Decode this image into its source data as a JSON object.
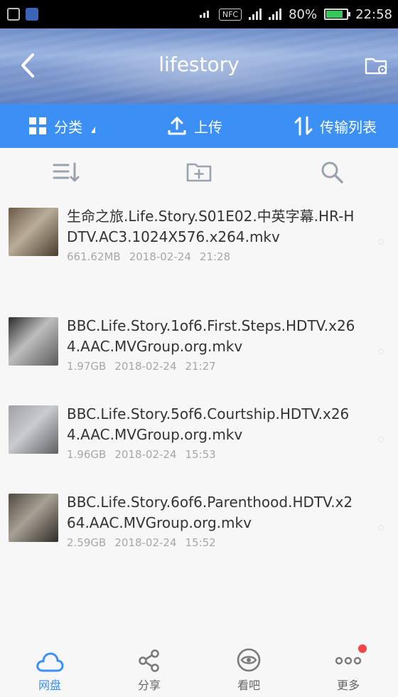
{
  "status_bar": {
    "nfc": "NFC",
    "battery": "80%",
    "battery_level": 0.8,
    "time": "22:58"
  },
  "header": {
    "title": "lifestory"
  },
  "toolbar": {
    "category": "分类",
    "upload": "上传",
    "transfer_list": "传输列表"
  },
  "files": [
    {
      "name": "生命之旅.Life.Story.S01E02.中英字幕.HR-HDTV.AC3.1024X576.x264.mkv",
      "size": "661.62MB",
      "date": "2018-02-24",
      "time": "21:28",
      "thumb_colors": [
        "#6b5a45",
        "#b9ad99",
        "#4a3c2c"
      ]
    },
    {
      "name": "BBC.Life.Story.1of6.First.Steps.HDTV.x264.AAC.MVGroup.org.mkv",
      "size": "1.97GB",
      "date": "2018-02-24",
      "time": "21:27",
      "thumb_colors": [
        "#2c2c2c",
        "#bdbdbd",
        "#5a5a5a"
      ]
    },
    {
      "name": "BBC.Life.Story.5of6.Courtship.HDTV.x264.AAC.MVGroup.org.mkv",
      "size": "1.96GB",
      "date": "2018-02-24",
      "time": "15:53",
      "thumb_colors": [
        "#9ea0a3",
        "#c9cccf",
        "#5e6062"
      ]
    },
    {
      "name": "BBC.Life.Story.6of6.Parenthood.HDTV.x264.AAC.MVGroup.org.mkv",
      "size": "2.59GB",
      "date": "2018-02-24",
      "time": "15:52",
      "thumb_colors": [
        "#4f4a42",
        "#a7a094",
        "#2f2b26"
      ]
    }
  ],
  "tabs": [
    {
      "label": "网盘",
      "icon": "cloud-icon",
      "active": true
    },
    {
      "label": "分享",
      "icon": "share-icon",
      "active": false
    },
    {
      "label": "看吧",
      "icon": "eye-icon",
      "active": false
    },
    {
      "label": "更多",
      "icon": "more-icon",
      "active": false,
      "badge": true
    }
  ],
  "colors": {
    "accent": "#3b8ff5",
    "badge": "#f04646"
  }
}
